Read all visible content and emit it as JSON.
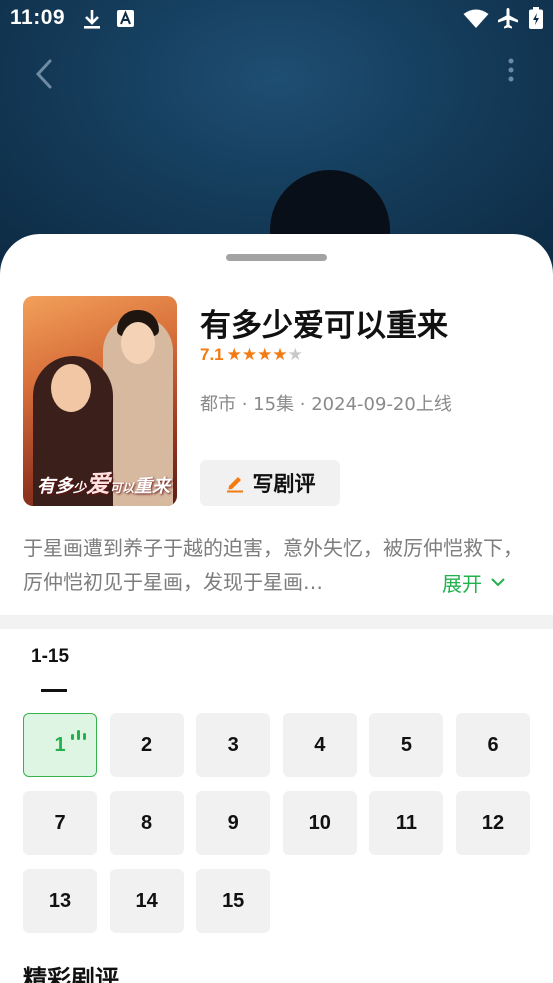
{
  "status_bar": {
    "time": "11:09",
    "icons": [
      "download-icon",
      "font-a-icon",
      "wifi-icon",
      "airplane-icon",
      "battery-icon"
    ]
  },
  "nav": {
    "back_icon": "chevron-left-icon",
    "more_icon": "more-vertical-icon"
  },
  "drama": {
    "title": "有多少爱可以重来",
    "score": "7.1",
    "stars": 4,
    "stars_total": 5,
    "meta": "都市 · 15集 · 2024-09-20上线",
    "poster_title": {
      "a": "有多",
      "b": "少",
      "c": "爱",
      "d": "可以",
      "e": "重来"
    },
    "review_button": "写剧评",
    "synopsis": "于星画遭到养子于越的迫害，意外失忆，被厉仲恺救下，厉仲恺初见于星画，发现于星画…",
    "expand_label": "展开"
  },
  "episodes": {
    "range_tab": "1-15",
    "items": [
      "1",
      "2",
      "3",
      "4",
      "5",
      "6",
      "7",
      "8",
      "9",
      "10",
      "11",
      "12",
      "13",
      "14",
      "15"
    ],
    "active_index": 0
  },
  "reviews": {
    "section_title": "精彩剧评"
  },
  "colors": {
    "accent_green": "#22b14c",
    "rating_orange": "#f47a12",
    "hero_bg": "#153d5c"
  }
}
